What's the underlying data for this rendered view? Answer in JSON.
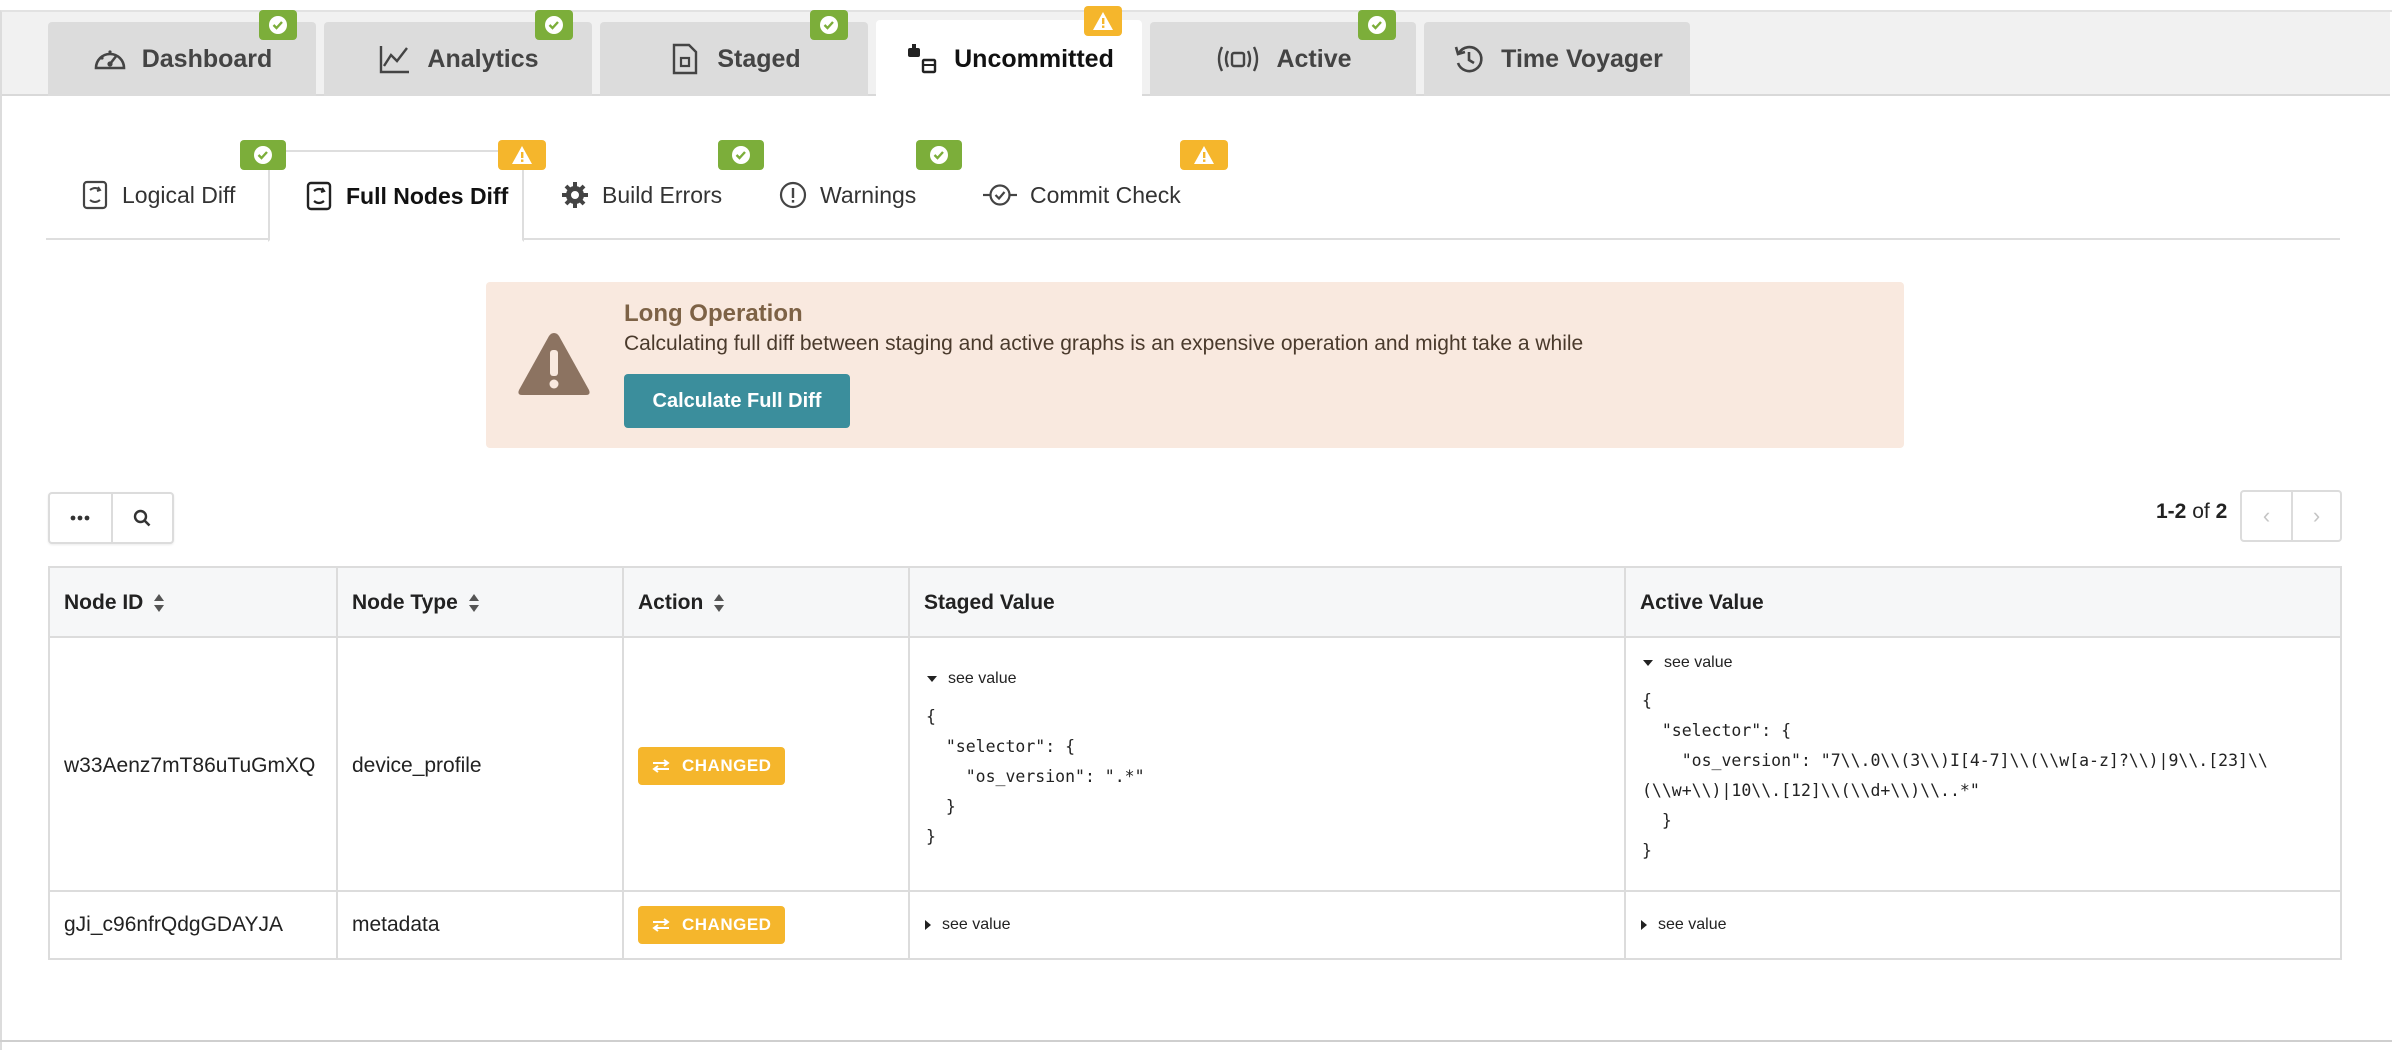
{
  "top_tabs": [
    {
      "label": "Dashboard",
      "icon": "dashboard-icon",
      "status": "ok"
    },
    {
      "label": "Analytics",
      "icon": "chart-line-icon",
      "status": "ok"
    },
    {
      "label": "Staged",
      "icon": "document-icon",
      "status": "ok"
    },
    {
      "label": "Uncommitted",
      "icon": "uncommitted-icon",
      "status": "warning",
      "active": true
    },
    {
      "label": "Active",
      "icon": "broadcast-icon",
      "status": "ok"
    },
    {
      "label": "Time Voyager",
      "icon": "history-icon",
      "status": "none"
    }
  ],
  "sub_tabs": [
    {
      "label": "Logical Diff",
      "icon": "diff-icon",
      "status": "ok"
    },
    {
      "label": "Full Nodes Diff",
      "icon": "diff-icon",
      "status": "warning",
      "active": true
    },
    {
      "label": "Build Errors",
      "icon": "gear-icon",
      "status": "ok"
    },
    {
      "label": "Warnings",
      "icon": "exclamation-circle-icon",
      "status": "ok"
    },
    {
      "label": "Commit Check",
      "icon": "commit-icon",
      "status": "warning"
    }
  ],
  "alert": {
    "title": "Long Operation",
    "message": "Calculating full diff between staging and active graphs is an expensive operation and might take a while",
    "button_label": "Calculate Full Diff"
  },
  "toolbar": {
    "more_icon": "ellipsis-icon",
    "search_icon": "search-icon"
  },
  "pagination": {
    "range": "1-2",
    "of_label": "of",
    "total": "2",
    "prev": "‹",
    "next": "›"
  },
  "table": {
    "columns": [
      "Node ID",
      "Node Type",
      "Action",
      "Staged Value",
      "Active Value"
    ],
    "rows": [
      {
        "node_id": "w33Aenz7mT86uTuGmXQ",
        "node_type": "device_profile",
        "action": "CHANGED",
        "staged": {
          "toggle": "see value",
          "expanded": true,
          "code": "{\n  \"selector\": {\n    \"os_version\": \".*\"\n  }\n}"
        },
        "active": {
          "toggle": "see value",
          "expanded": true,
          "code": "{\n  \"selector\": {\n    \"os_version\": \"7\\\\.0\\\\(3\\\\)I[4-7]\\\\(\\\\w[a-z]?\\\\)|9\\\\.[23]\\\\\n(\\\\w+\\\\)|10\\\\.[12]\\\\(\\\\d+\\\\)\\\\..*\"\n  }\n}"
        }
      },
      {
        "node_id": "gJi_c96nfrQdgGDAYJA",
        "node_type": "metadata",
        "action": "CHANGED",
        "staged": {
          "toggle": "see value",
          "expanded": false
        },
        "active": {
          "toggle": "see value",
          "expanded": false
        }
      }
    ]
  },
  "colors": {
    "ok": "#7cae3a",
    "warning": "#f5b62c",
    "primary_button": "#3b8e9c",
    "alert_bg": "#f9e9df"
  }
}
